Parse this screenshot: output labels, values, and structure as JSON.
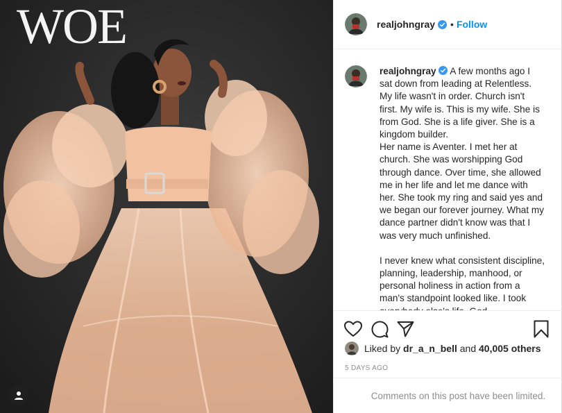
{
  "photo": {
    "magazine_logo": "WOE",
    "tag_icon": "user-tag-icon"
  },
  "header": {
    "username": "realjohngray",
    "separator": "•",
    "follow_label": "Follow"
  },
  "caption": {
    "username": "realjohngray",
    "paragraph_1": "A few months ago I sat down from leading at Relentless. My life wasn't in order. Church isn't first. My wife is. This is my wife. She is from God. She is a life giver. She is a kingdom builder.",
    "paragraph_2": "Her name is Aventer. I met her at church. She was worshipping God through dance. Over time, she allowed me in her life and let me dance with her. She took my ring and said yes and we began our forever journey. What my dance partner didn't know was that I was very much unfinished.",
    "paragraph_3": "I never knew what consistent discipline, planning, leadership, manhood, or personal holiness in action from a man's standpoint looked like. I took everybody else's life. God..."
  },
  "actions": {
    "like_icon": "heart-icon",
    "comment_icon": "comment-icon",
    "share_icon": "paper-plane-icon",
    "save_icon": "bookmark-icon"
  },
  "likes": {
    "prefix": "Liked by",
    "user": "dr_a_n_bell",
    "connector": "and",
    "others": "40,005 others"
  },
  "timestamp": "5 DAYS AGO",
  "comments_notice": "Comments on this post have been limited.",
  "colors": {
    "accent": "#0095f6",
    "verified": "#3897f0",
    "text": "#262626",
    "muted": "#8e8e8e",
    "photo_background": "#2a2a2a",
    "gown": "#f2c4a4"
  }
}
